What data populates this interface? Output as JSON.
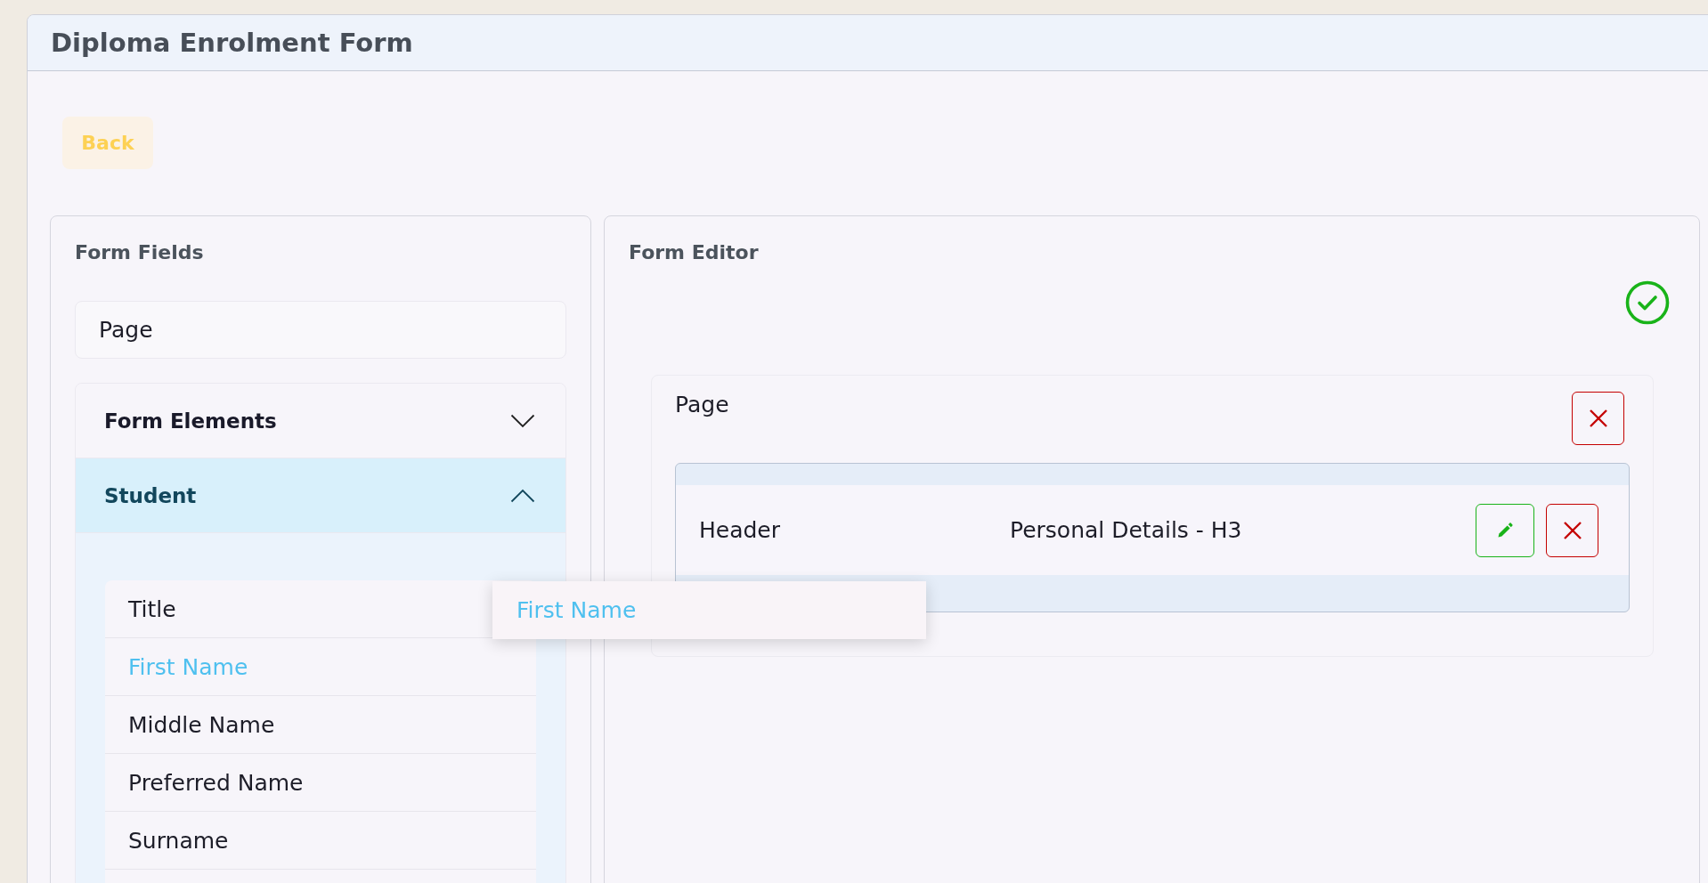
{
  "window": {
    "title": "Diploma Enrolment Form"
  },
  "back_button": {
    "label": "Back"
  },
  "form_fields": {
    "title": "Form Fields",
    "page_item": "Page",
    "groups": [
      {
        "label": "Form Elements",
        "expanded": false
      },
      {
        "label": "Student",
        "expanded": true,
        "items": [
          {
            "label": "Title",
            "selected": false
          },
          {
            "label": "First Name",
            "selected": true
          },
          {
            "label": "Middle Name",
            "selected": false
          },
          {
            "label": "Preferred Name",
            "selected": false
          },
          {
            "label": "Surname",
            "selected": false
          }
        ]
      }
    ]
  },
  "drag_preview": {
    "label": "First Name"
  },
  "form_editor": {
    "title": "Form Editor",
    "saved": true,
    "page": {
      "label": "Page",
      "rows": [
        {
          "type": "Header",
          "value": "Personal Details - H3"
        }
      ]
    }
  }
}
